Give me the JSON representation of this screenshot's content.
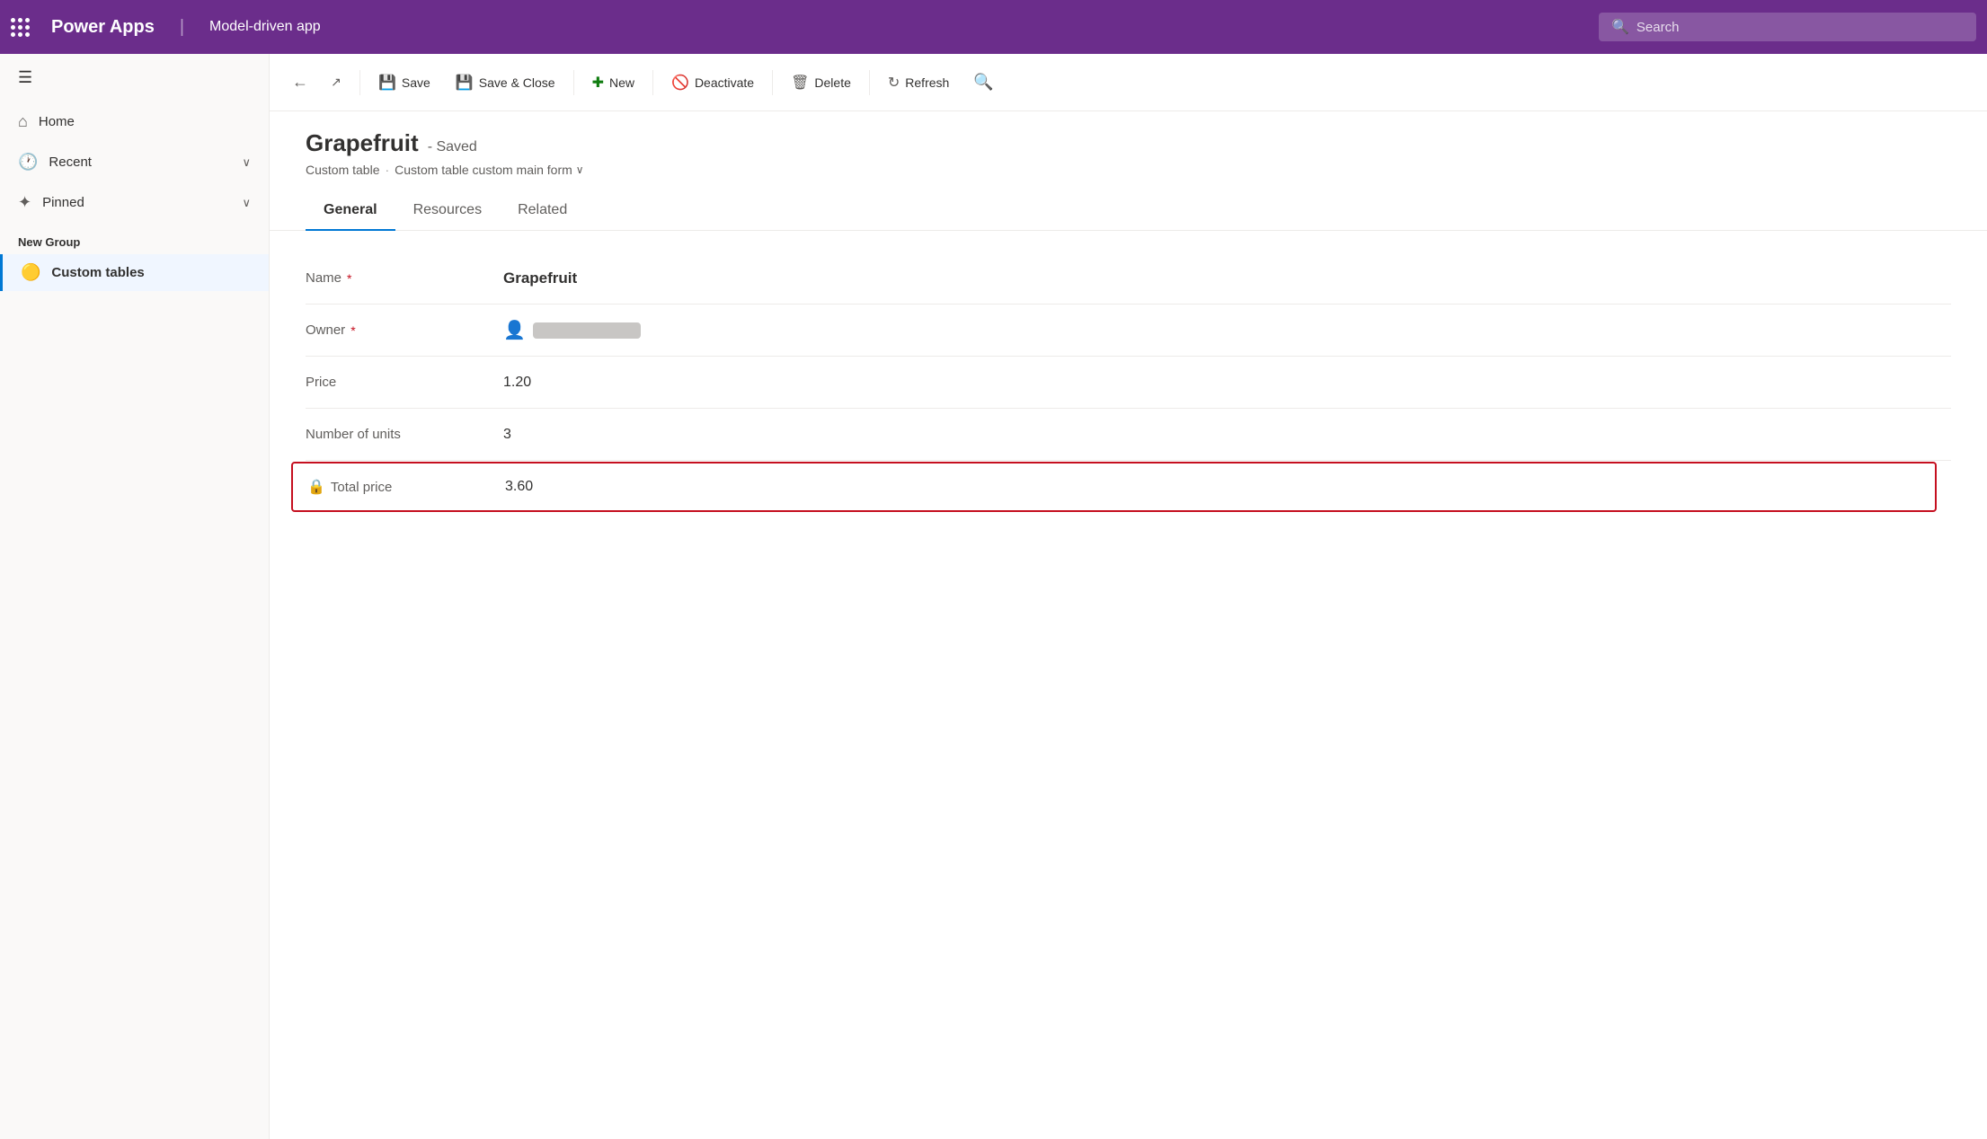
{
  "app": {
    "title": "Power Apps",
    "subtitle": "Model-driven app",
    "search_placeholder": "Search"
  },
  "toolbar": {
    "back_label": "←",
    "external_link_label": "↗",
    "save_label": "Save",
    "save_close_label": "Save & Close",
    "new_label": "New",
    "deactivate_label": "Deactivate",
    "delete_label": "Delete",
    "refresh_label": "Refresh",
    "search_label": "🔍"
  },
  "sidebar": {
    "hamburger": "☰",
    "home_label": "Home",
    "recent_label": "Recent",
    "pinned_label": "Pinned",
    "new_group_label": "New Group",
    "nav_items": [
      {
        "id": "custom-tables",
        "label": "Custom tables",
        "emoji": "🟡",
        "active": true
      }
    ]
  },
  "record": {
    "title": "Grapefruit",
    "status": "- Saved",
    "breadcrumb_table": "Custom table",
    "breadcrumb_form": "Custom table custom main form",
    "tabs": [
      {
        "id": "general",
        "label": "General",
        "active": true
      },
      {
        "id": "resources",
        "label": "Resources",
        "active": false
      },
      {
        "id": "related",
        "label": "Related",
        "active": false
      }
    ],
    "fields": [
      {
        "id": "name",
        "label": "Name",
        "required": true,
        "value": "Grapefruit",
        "type": "text",
        "highlighted": false
      },
      {
        "id": "owner",
        "label": "Owner",
        "required": true,
        "value": "[owner]",
        "type": "owner",
        "highlighted": false
      },
      {
        "id": "price",
        "label": "Price",
        "required": false,
        "value": "1.20",
        "type": "number",
        "highlighted": false
      },
      {
        "id": "number_of_units",
        "label": "Number of units",
        "required": false,
        "value": "3",
        "type": "number",
        "highlighted": false
      },
      {
        "id": "total_price",
        "label": "Total price",
        "required": false,
        "value": "3.60",
        "type": "number",
        "highlighted": true,
        "locked": true
      }
    ]
  }
}
